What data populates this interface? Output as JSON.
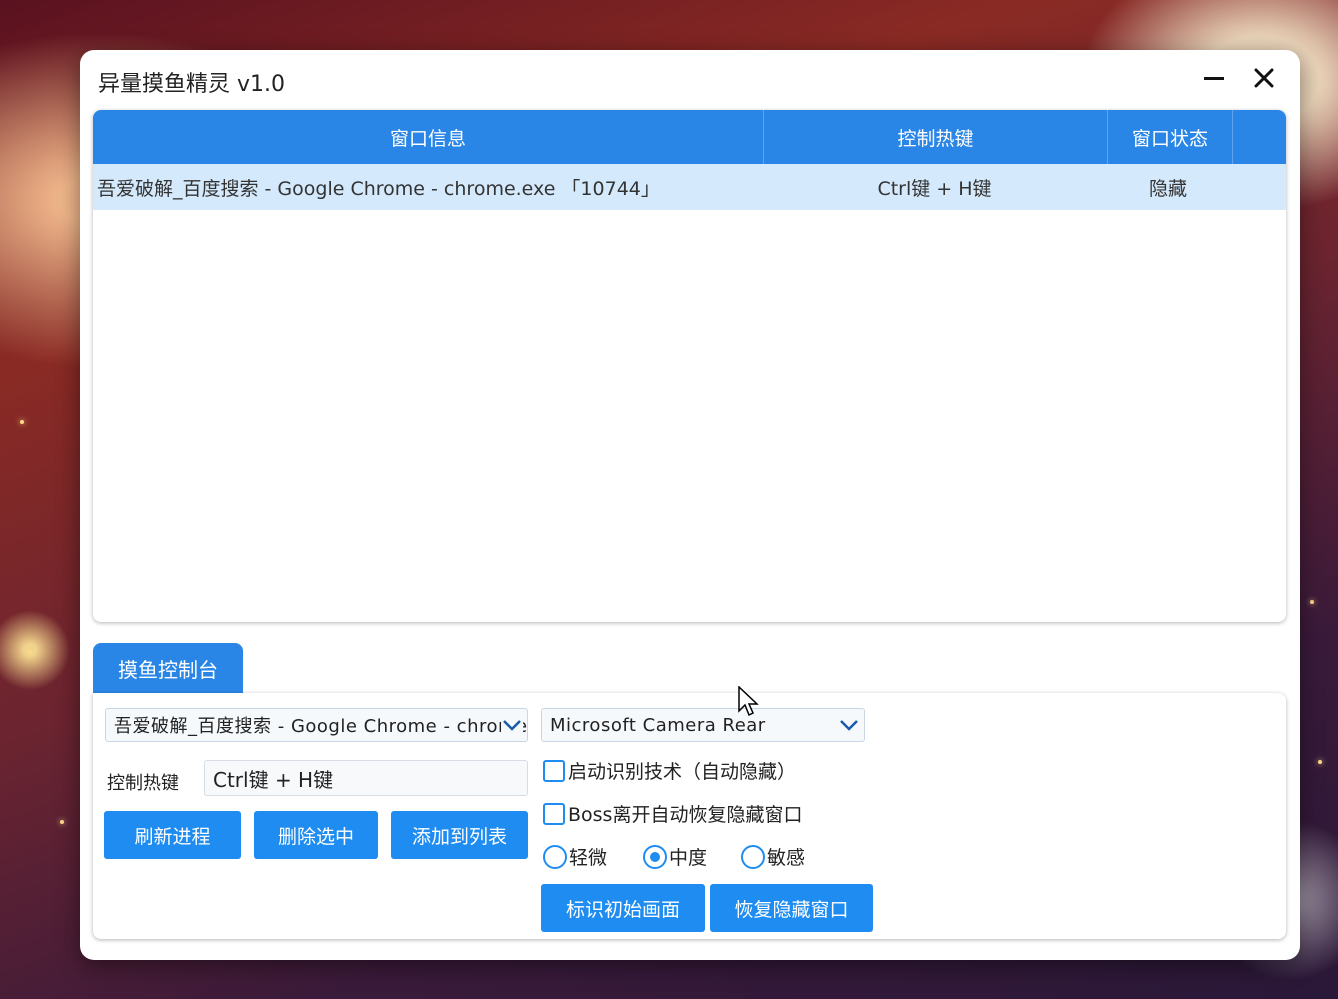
{
  "window": {
    "title": "异量摸鱼精灵 v1.0"
  },
  "table": {
    "headers": [
      "窗口信息",
      "控制热键",
      "窗口状态"
    ],
    "rows": [
      {
        "info": "吾爱破解_百度搜索 - Google Chrome - chrome.exe 「10744」",
        "hotkey": "Ctrl键 + H键",
        "status": "隐藏"
      }
    ]
  },
  "control": {
    "tab_label": "摸鱼控制台",
    "window_select": "吾爱破解_百度搜索 - Google Chrome - chrome.exe",
    "camera_select": "Microsoft Camera Rear",
    "hotkey_label": "控制热键",
    "hotkey_value": "Ctrl键 + H键",
    "buttons": {
      "refresh": "刷新进程",
      "delete": "删除选中",
      "add": "添加到列表",
      "mark": "标识初始画面",
      "restore": "恢复隐藏窗口"
    },
    "checkboxes": {
      "auto_detect": "启动识别技术（自动隐藏）",
      "boss_restore": "Boss离开自动恢复隐藏窗口"
    },
    "sensitivity": {
      "options": [
        "轻微",
        "中度",
        "敏感"
      ],
      "selected": "中度"
    }
  },
  "colors": {
    "accent": "#2a86e6",
    "button": "#1e8cf0",
    "row_selected": "#d4e9fb"
  }
}
